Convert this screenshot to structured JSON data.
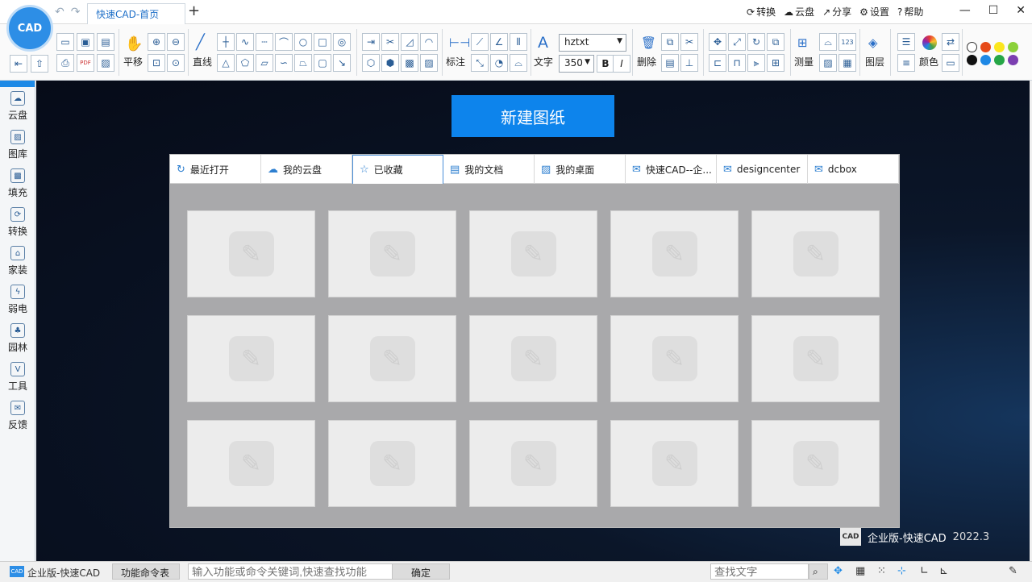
{
  "window": {
    "tab_title": "快速CAD-首页",
    "new_tab": "+",
    "menu": {
      "convert": "转换",
      "cloud": "云盘",
      "share": "分享",
      "settings": "设置",
      "help": "帮助"
    },
    "controls": {
      "minimize": "—",
      "maximize": "☐",
      "close": "✕"
    }
  },
  "logo_text": "CAD",
  "ribbon": {
    "pan": "平移",
    "line": "直线",
    "dimension": "标注",
    "text": "文字",
    "font": "hztxt",
    "font_size": "350",
    "bold": "B",
    "italic": "I",
    "delete": "删除",
    "measure": "测量",
    "layer": "图层",
    "color": "颜色"
  },
  "colors": {
    "swatches": [
      "#ffffff",
      "#e64a19",
      "#fbe61e",
      "#8bd13a",
      "#111111",
      "#1e88e5",
      "#26a646",
      "#7b3fb0"
    ],
    "accent": "#0d84ec"
  },
  "sidebar": {
    "items": [
      {
        "label": "云盘",
        "icon": "cloud-icon"
      },
      {
        "label": "图库",
        "icon": "gallery-icon"
      },
      {
        "label": "填充",
        "icon": "hatch-icon"
      },
      {
        "label": "转换",
        "icon": "convert-icon"
      },
      {
        "label": "家装",
        "icon": "home-icon"
      },
      {
        "label": "弱电",
        "icon": "bolt-icon"
      },
      {
        "label": "园林",
        "icon": "tree-icon"
      },
      {
        "label": "工具",
        "icon": "tools-icon"
      },
      {
        "label": "反馈",
        "icon": "mail-icon"
      }
    ]
  },
  "main": {
    "new_drawing": "新建图纸",
    "tabs": [
      {
        "label": "最近打开",
        "icon": "refresh-icon"
      },
      {
        "label": "我的云盘",
        "icon": "cloud-icon"
      },
      {
        "label": "已收藏",
        "icon": "star-icon"
      },
      {
        "label": "我的文档",
        "icon": "document-icon"
      },
      {
        "label": "我的桌面",
        "icon": "desktop-icon"
      },
      {
        "label": "快速CAD--企...",
        "icon": "mail-icon"
      },
      {
        "label": "designcenter",
        "icon": "mail-icon"
      },
      {
        "label": "dcbox",
        "icon": "mail-icon"
      }
    ],
    "active_tab": 2,
    "brand": "企业版-快速CAD",
    "version": "2022.3",
    "brand_logo": "CAD"
  },
  "status": {
    "app_name": "企业版-快速CAD",
    "command_table": "功能命令表",
    "search_placeholder": "输入功能或命令关键词,快速查找功能",
    "confirm": "确定",
    "find_text_placeholder": "查找文字"
  }
}
